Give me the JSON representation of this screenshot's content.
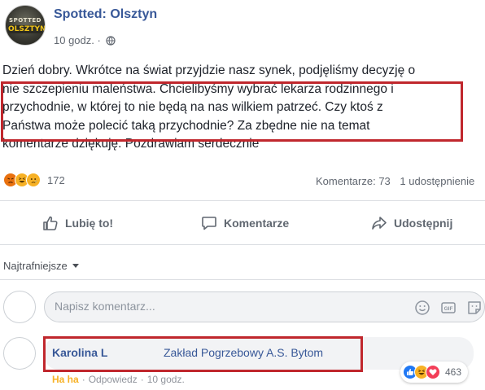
{
  "page": {
    "name": "Spotted: Olsztyn",
    "logo_top": "SPOTTED",
    "logo_bottom": "OLSZTYN",
    "time": "10 godz. ·"
  },
  "post": {
    "lines": [
      "Dzień dobry. Wkrótce na świat przyjdzie nasz synek, podjęliśmy decyzję o",
      "nie szczepieniu maleństwa. Chcielibyśmy wybrać lekarza rodzinnego i",
      "przychodnie, w której to nie będą na nas wilkiem patrzeć. Czy ktoś z",
      "Państwa może polecić taką przychodnie? Za zbędne nie na temat",
      "komentarze dziękuję. Pozdrawiam serdecznie"
    ],
    "reaction_count": "172",
    "comments_count": "Komentarze: 73",
    "shares_count": "1 udostępnienie"
  },
  "actions": {
    "like": "Lubię to!",
    "comment": "Komentarze",
    "share": "Udostępnij"
  },
  "sort": {
    "label": "Najtrafniejsze"
  },
  "comment_input": {
    "placeholder": "Napisz komentarz..."
  },
  "comment": {
    "author": "Karolina L",
    "text": "Zakład Pogrzebowy A.S. Bytom",
    "haha": "Ha ha",
    "reply": "Odpowiedz",
    "time": "10 godz.",
    "reaction_count": "463"
  },
  "colors": {
    "link": "#385898",
    "highlight": "#c0272d",
    "haha": "#f7b125"
  }
}
